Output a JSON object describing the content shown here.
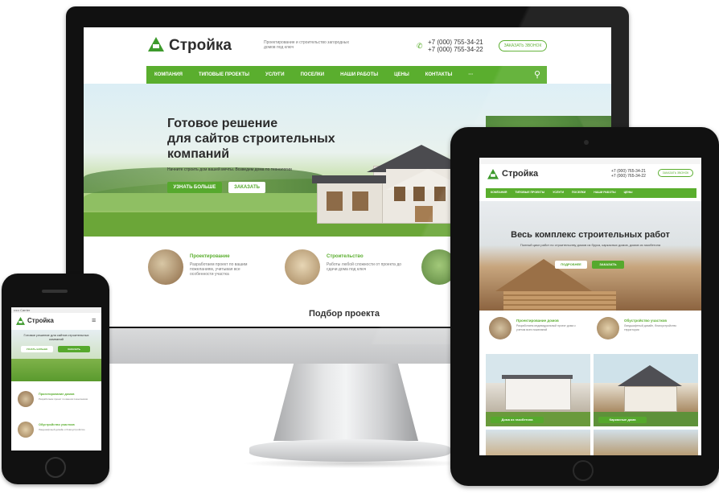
{
  "brand": "Стройка",
  "monitor": {
    "tagline": "Проектирование и строительство загородных домов под ключ",
    "phone1": "+7 (000) 755-34-21",
    "phone2": "+7 (000) 755-34-22",
    "callback_label": "Заказать звонок",
    "nav": [
      "Компания",
      "Типовые проекты",
      "Услуги",
      "Поселки",
      "Наши работы",
      "Цены",
      "Контакты",
      "···"
    ],
    "hero_title_1": "Готовое решение",
    "hero_title_2": "для сайтов строительных",
    "hero_title_3": "компаний",
    "hero_sub": "Начните строить дом вашей мечты. Возведем дома по технологии",
    "btn_more": "Узнать больше",
    "btn_order": "Заказать",
    "services": [
      {
        "title": "Проектирование",
        "text": "Разработаем проект по вашим пожеланиям, учитывая все особенности участка"
      },
      {
        "title": "Строительство",
        "text": "Работы любой сложности от проекта до сдачи дома под ключ"
      }
    ],
    "section_title": "Подбор проекта"
  },
  "tablet": {
    "phone1": "+7 (000) 765-34-21",
    "phone2": "+7 (000) 765-34-22",
    "callback_label": "Заказать звонок",
    "nav": [
      "Компания",
      "Типовые проекты",
      "Услуги",
      "Поселки",
      "Наши работы",
      "Цены"
    ],
    "hero_title": "Весь комплекс строительных работ",
    "hero_sub": "Полный цикл работ по строительству домов из бруса, каркасных домов, домов из газобетона",
    "btn_more": "Подробнее",
    "btn_order": "Заказать",
    "services": [
      {
        "title": "Проектирование домов",
        "text": "Разработаем индивидуальный проект дома с учетом всех пожеланий"
      },
      {
        "title": "Обустройство участков",
        "text": "Ландшафтный дизайн, благоустройство территории"
      }
    ],
    "cards": [
      "Дома из газобетона",
      "Каркасные дома"
    ]
  },
  "phone": {
    "status": "••••• Carrier",
    "hero_text": "Готовое решение для сайтов строительных компаний",
    "btn_more": "Узнать больше",
    "btn_order": "Заказать",
    "services": [
      {
        "title": "Проектирование домов",
        "text": "Разработаем проект по вашим пожеланиям"
      },
      {
        "title": "Обустройство участков",
        "text": "Ландшафтный дизайн и благоустройство"
      }
    ]
  },
  "colors": {
    "accent": "#5aae2e",
    "dark": "#111111"
  },
  "icons": [
    "logo-icon",
    "search-icon",
    "phone-icon",
    "menu-icon",
    "home-button-icon",
    "camera-icon"
  ]
}
